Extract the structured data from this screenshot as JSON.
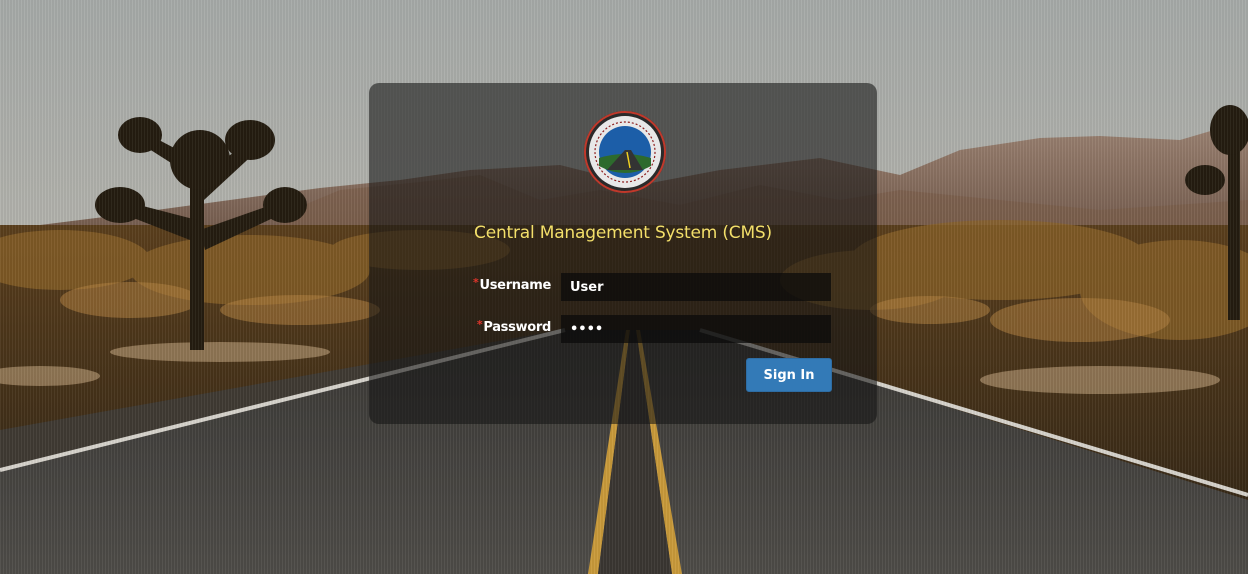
{
  "app": {
    "title": "Central Management System (CMS)",
    "logo_text": "ROADS AND HIGHWAYS DEPARTMENT"
  },
  "login": {
    "username_label": "Username",
    "password_label": "Password",
    "required_marker": "*",
    "username_value": "User",
    "password_value": "••••",
    "signin_label": "Sign In"
  },
  "colors": {
    "title": "#f3df6a",
    "button": "#337ab7",
    "required": "#e0352b"
  }
}
